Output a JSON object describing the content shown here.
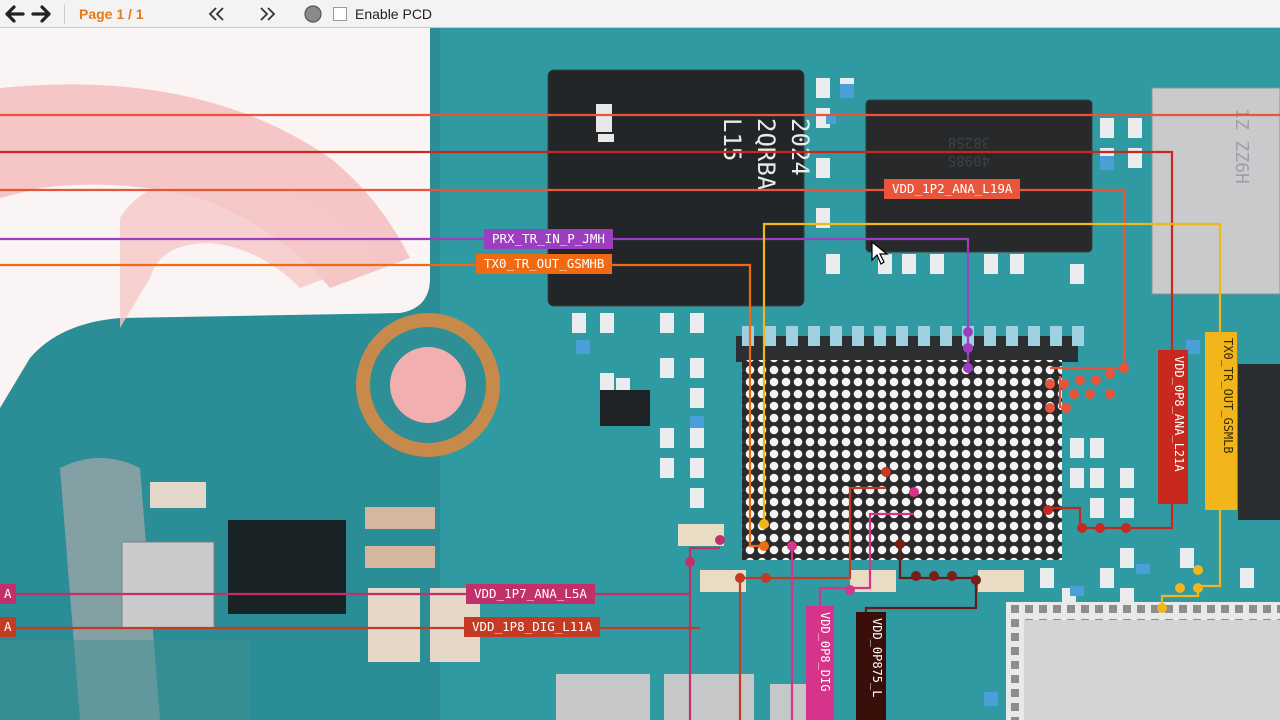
{
  "toolbar": {
    "page_indicator": "Page 1 / 1",
    "enable_pcd_label": "Enable PCD",
    "back_icon": "arrow-left-icon",
    "forward_icon": "arrow-right-icon",
    "first_icon": "double-chevron-left-icon",
    "last_icon": "double-chevron-right-icon",
    "record_icon": "circle-icon",
    "accent_color": "#e07a1f"
  },
  "board": {
    "chip_main_marking": [
      "L15",
      "2QRBA",
      "2024"
    ],
    "chip_top_right_marking": [
      "382S8",
      "4098S"
    ],
    "chip_right_marking": [
      "1Z ZZ6H"
    ]
  },
  "net_labels": {
    "vdd_1p2_ana_l19a": "VDD_1P2_ANA_L19A",
    "prx_tr_in_p_jmh": "PRX_TR_IN_P_JMH",
    "tx0_tr_out_gsmhb": "TX0_TR_OUT_GSMHB",
    "vdd_0p8_ana_l21a": "VDD_0P8_ANA_L21A",
    "tx0_tr_out_gsmlb": "TX0_TR_OUT_GSMLB",
    "vdd_1p7_ana_l5a": "VDD_1P7_ANA_L5A",
    "vdd_1p8_dig_l11a": "VDD_1P8_DIG_L11A",
    "vdd_0p8_dig": "VDD_0P8_DIG",
    "vdd_0p875_l": "VDD_0P875_L",
    "left_edge_a1": "A",
    "left_edge_a2": "A"
  },
  "net_colors": {
    "vdd_1p2_ana_l19a": "#e8553a",
    "prx_tr_in_p_jmh": "#9b3fc0",
    "tx0_tr_out_gsmhb": "#ef6a12",
    "vdd_0p8_ana_l21a": "#c8281e",
    "tx0_tr_out_gsmlb": "#f2b51a",
    "vdd_1p7_ana_l5a": "#c2306a",
    "vdd_1p8_dig_l11a": "#c43a22",
    "vdd_0p8_dig": "#d6338a",
    "vdd_0p875_l": "#6a1a12"
  }
}
